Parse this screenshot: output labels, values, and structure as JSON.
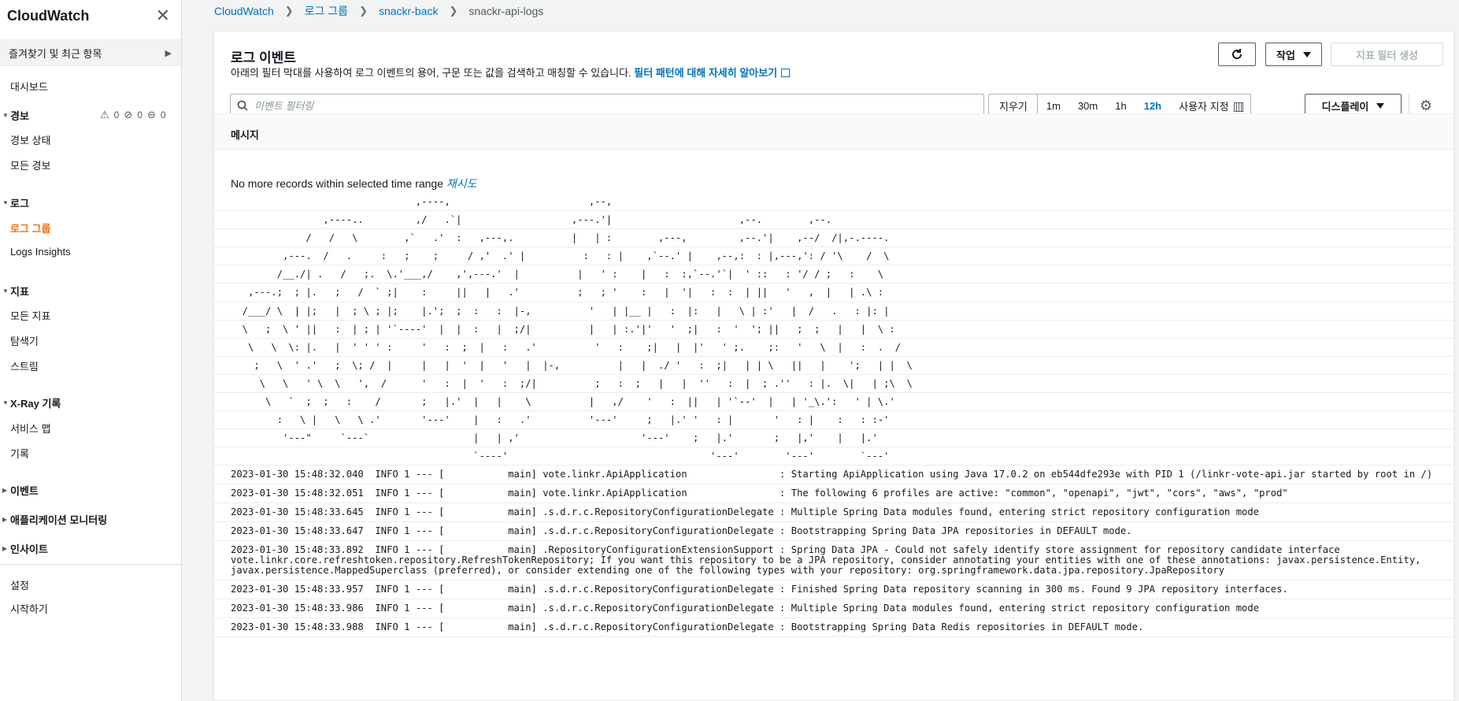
{
  "sidebar": {
    "title": "CloudWatch",
    "favorites": "즐겨찾기 및 최근 항목",
    "dashboard": "대시보드",
    "alarms": {
      "label": "경보",
      "count_alarm": "0",
      "count_ok": "0",
      "count_insufficient": "0",
      "items": [
        "경보 상태",
        "모든 경보"
      ]
    },
    "logs": {
      "label": "로그",
      "items": [
        "로그 그룹",
        "Logs Insights"
      ]
    },
    "metrics": {
      "label": "지표",
      "items": [
        "모든 지표",
        "탐색기",
        "스트림"
      ]
    },
    "xray": {
      "label": "X-Ray 기록",
      "items": [
        "서비스 맵",
        "기록"
      ]
    },
    "events": "이벤트",
    "app_monitoring": "애플리케이션 모니터링",
    "insights": "인사이트",
    "settings": "설정",
    "getting_started": "시작하기"
  },
  "breadcrumb": [
    "CloudWatch",
    "로그 그룹",
    "snackr-back",
    "snackr-api-logs"
  ],
  "panel": {
    "title": "로그 이벤트",
    "description": "아래의 필터 막대를 사용하여 로그 이벤트의 용어, 구문 또는 값을 검색하고 매칭할 수 있습니다.",
    "learn_more": "필터 패턴에 대해 자세히 알아보기",
    "actions_button": "작업",
    "create_metric_filter": "지표 필터 생성",
    "filter_placeholder": "이벤트 필터링",
    "time": {
      "clear": "지우기",
      "options": [
        "1m",
        "30m",
        "1h",
        "12h"
      ],
      "selected": "12h",
      "custom": "사용자 지정"
    },
    "display_button": "디스플레이",
    "column_header": "메시지",
    "no_more": "No more records within selected time range",
    "retry": "재시도"
  },
  "ascii_banner": [
    "                                ,----,                        ,--,",
    "                ,----..         ,/   .`|                   ,---.'|                      ,--.        ,--.",
    "             /   /   \\        ,`   .'  :   ,---,.          |   | :        ,---,         ,--.'|    ,--/  /|,-.----.",
    "         ,---.  /   .     :   ;    ;     / ,'  .' |          :   : |    ,`--.' |    ,--,:  : |,---,': / '\\    /  \\",
    "        /__./| .   /   ;.  \\.'___,/    ,',---.'  |          |   ' :    |   :  :,`--.'`|  ' ::   : '/ / ;   :    \\",
    "   ,---.;  ; |.   ;   /  ` ;|    :     ||   |   .'          ;   ; '    :   |  '|   :  :  | ||   '   ,  |   | .\\ :",
    "  /___/ \\  | |;   |  ; \\ ; |;    |.';  ;  :   :  |-,          '   | |__ |   :  |:   |   \\ | :'   |  /   .   : |: |",
    "  \\   ;  \\ ' ||   :  | ; | '`----'  |  |  :   |  ;/|          |   | :.'|'   '  ;|   :  '  '; ||   ;  ;   |   |  \\ :",
    "   \\   \\  \\: |.   |  ' ' ' :     '   :  ;  |   :   .'          '   :    ;|   |  |'   ' ;.    ;:   '   \\  |   :  .  /",
    "    ;   \\  ' .'   ;  \\; /  |     |   |  '  |   '   |  |-,          |   |  ./ '   :  ;|   | | \\   ||   |    ';   | |  \\",
    "     \\   \\   ' \\  \\   ',  /      '   :  |  '   :  ;/|          ;   :  ;   |   |  ''   :  |  ; .''   : |.  \\|   | ;\\  \\",
    "      \\   `  ;  ;   :    /       ;   |.'  |   |    \\          |   ,/    '   :  ||   | '`--'  |   | '_\\.':   ' | \\.'",
    "        :   \\ |   \\   \\ .'       '---'    |   :   .'          '---'     ;   |.' '   : |       '   : |    :   : :-'",
    "         '---\"     `---`                  |   | ,'                     '---'    ;   |.'       ;   |,'    |   |.'",
    "                                          `----'                                   '---'        '---'        `---'"
  ],
  "log_lines": [
    "2023-01-30 15:48:32.040  INFO 1 --- [           main] vote.linkr.ApiApplication                : Starting ApiApplication using Java 17.0.2 on eb544dfe293e with PID 1 (/linkr-vote-api.jar started by root in /)",
    "2023-01-30 15:48:32.051  INFO 1 --- [           main] vote.linkr.ApiApplication                : The following 6 profiles are active: \"common\", \"openapi\", \"jwt\", \"cors\", \"aws\", \"prod\"",
    "2023-01-30 15:48:33.645  INFO 1 --- [           main] .s.d.r.c.RepositoryConfigurationDelegate : Multiple Spring Data modules found, entering strict repository configuration mode",
    "2023-01-30 15:48:33.647  INFO 1 --- [           main] .s.d.r.c.RepositoryConfigurationDelegate : Bootstrapping Spring Data JPA repositories in DEFAULT mode.",
    "2023-01-30 15:48:33.892  INFO 1 --- [           main] .RepositoryConfigurationExtensionSupport : Spring Data JPA - Could not safely identify store assignment for repository candidate interface vote.linkr.core.refreshtoken.repository.RefreshTokenRepository; If you want this repository to be a JPA repository, consider annotating your entities with one of these annotations: javax.persistence.Entity, javax.persistence.MappedSuperclass (preferred), or consider extending one of the following types with your repository: org.springframework.data.jpa.repository.JpaRepository",
    "2023-01-30 15:48:33.957  INFO 1 --- [           main] .s.d.r.c.RepositoryConfigurationDelegate : Finished Spring Data repository scanning in 300 ms. Found 9 JPA repository interfaces.",
    "2023-01-30 15:48:33.986  INFO 1 --- [           main] .s.d.r.c.RepositoryConfigurationDelegate : Multiple Spring Data modules found, entering strict repository configuration mode",
    "2023-01-30 15:48:33.988  INFO 1 --- [           main] .s.d.r.c.RepositoryConfigurationDelegate : Bootstrapping Spring Data Redis repositories in DEFAULT mode."
  ],
  "colors": {
    "link": "#0073bb",
    "active_nav": "#ec7211",
    "border": "#eaeded"
  }
}
